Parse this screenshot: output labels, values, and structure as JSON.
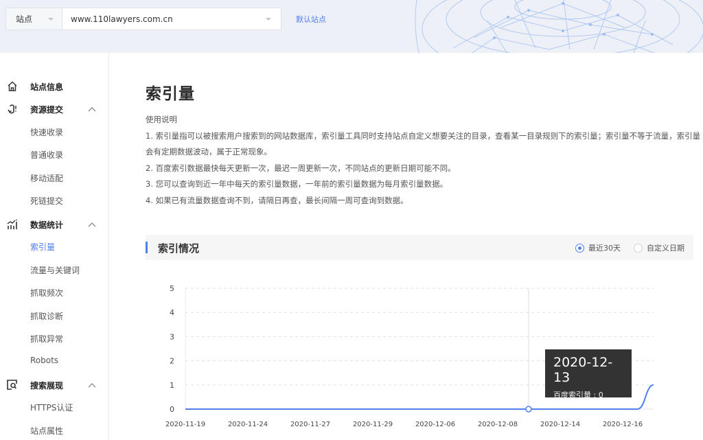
{
  "header": {
    "site_type_label": "站点",
    "site_url": "www.110lawyers.com.cn",
    "default_site_link": "默认站点"
  },
  "sidebar": {
    "groups": [
      {
        "label": "站点信息",
        "icon": "home-icon",
        "expandable": false,
        "items": []
      },
      {
        "label": "资源提交",
        "icon": "submit-hook-icon",
        "expandable": true,
        "expanded": true,
        "items": [
          "快速收录",
          "普通收录",
          "移动适配",
          "死链提交"
        ]
      },
      {
        "label": "数据统计",
        "icon": "stats-chart-icon",
        "expandable": true,
        "expanded": true,
        "items": [
          "索引量",
          "流量与关键词",
          "抓取频次",
          "抓取诊断",
          "抓取异常",
          "Robots"
        ]
      },
      {
        "label": "搜索展现",
        "icon": "search-display-icon",
        "expandable": true,
        "expanded": true,
        "items": [
          "HTTPS认证",
          "站点属性"
        ]
      }
    ],
    "active_item": "索引量"
  },
  "main": {
    "title": "索引量",
    "usage_heading": "使用说明",
    "usage_lines": [
      "1. 索引量指可以被搜索用户搜索到的网站数据库，索引量工具同时支持站点自定义想要关注的目录，查看某一目录规则下的索引量；索引量不等于流量，索引量会有定期数据波动，属于正常现象。",
      "2. 百度索引数据最快每天更新一次，最迟一周更新一次，不同站点的更新日期可能不同。",
      "3. 您可以查询到近一年中每天的索引量数据，一年前的索引量数据为每月索引量数据。",
      "4. 如果已有流量数据查询不到，请隔日再查，最长间隔一周可查询到数据。"
    ],
    "section_title": "索引情况",
    "range_options": [
      {
        "label": "最近30天",
        "selected": true
      },
      {
        "label": "自定义日期",
        "selected": false
      }
    ],
    "tooltip": {
      "date": "2020-12-13",
      "series_label": "百度索引量",
      "value": "0"
    }
  },
  "colors": {
    "accent": "#4e7ff0",
    "line": "#4e7ff0",
    "tooltip_bg": "#282828"
  },
  "chart_data": {
    "type": "line",
    "title": "",
    "xlabel": "",
    "ylabel": "",
    "ylim": [
      0,
      5
    ],
    "y_ticks": [
      "0",
      "1",
      "2",
      "3",
      "4",
      "5"
    ],
    "x_tick_labels": [
      "2020-11-19",
      "2020-11-24",
      "2020-11-27",
      "2020-11-29",
      "2020-12-06",
      "2020-12-08",
      "2020-12-14",
      "2020-12-16"
    ],
    "grid": true,
    "series": [
      {
        "name": "百度索引量",
        "x": [
          "2020-11-19",
          "2020-11-20",
          "2020-11-21",
          "2020-11-22",
          "2020-11-23",
          "2020-11-24",
          "2020-11-25",
          "2020-11-26",
          "2020-11-27",
          "2020-11-28",
          "2020-11-29",
          "2020-11-30",
          "2020-12-01",
          "2020-12-02",
          "2020-12-03",
          "2020-12-04",
          "2020-12-05",
          "2020-12-06",
          "2020-12-07",
          "2020-12-08",
          "2020-12-09",
          "2020-12-10",
          "2020-12-11",
          "2020-12-12",
          "2020-12-13",
          "2020-12-14",
          "2020-12-15",
          "2020-12-16",
          "2020-12-17",
          "2020-12-18"
        ],
        "values": [
          0,
          0,
          0,
          0,
          0,
          0,
          0,
          0,
          0,
          0,
          0,
          0,
          0,
          0,
          0,
          0,
          0,
          0,
          0,
          0,
          0,
          0,
          0,
          0,
          0,
          0,
          0,
          0,
          0,
          1
        ]
      }
    ],
    "highlight_index": 24
  }
}
